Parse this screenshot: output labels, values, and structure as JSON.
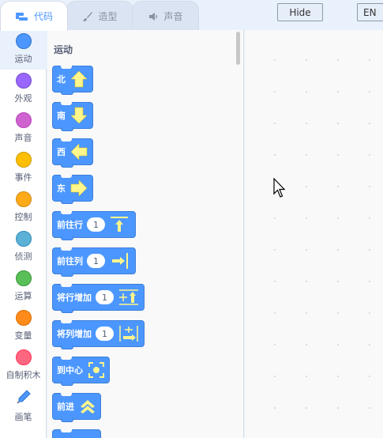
{
  "tabs": [
    {
      "label": "代码",
      "icon": "code-icon",
      "active": true
    },
    {
      "label": "造型",
      "icon": "brush-icon",
      "active": false
    },
    {
      "label": "声音",
      "icon": "speaker-icon",
      "active": false
    }
  ],
  "header_buttons": {
    "hide_label": "Hide",
    "lang_label": "EN"
  },
  "categories": [
    {
      "label": "运动",
      "color": "#4c97ff"
    },
    {
      "label": "外观",
      "color": "#9966ff"
    },
    {
      "label": "声音",
      "color": "#cf63cf"
    },
    {
      "label": "事件",
      "color": "#ffbf00"
    },
    {
      "label": "控制",
      "color": "#ffab19"
    },
    {
      "label": "侦测",
      "color": "#5cb1d6"
    },
    {
      "label": "运算",
      "color": "#59c059"
    },
    {
      "label": "变量",
      "color": "#ff8c1a"
    },
    {
      "label": "自制积木",
      "color": "#ff6680"
    },
    {
      "label": "画笔",
      "icon": "pen-icon"
    }
  ],
  "palette": {
    "title": "运动",
    "blocks": [
      {
        "label": "北",
        "icon": "arrow-up-icon"
      },
      {
        "label": "南",
        "icon": "arrow-down-icon"
      },
      {
        "label": "西",
        "icon": "arrow-left-icon"
      },
      {
        "label": "东",
        "icon": "arrow-right-icon"
      },
      {
        "label": "前往行",
        "value": "1",
        "icon": "goto-row-icon"
      },
      {
        "label": "前往列",
        "value": "1",
        "icon": "goto-col-icon"
      },
      {
        "label": "将行增加",
        "value": "1",
        "icon": "row-increase-icon"
      },
      {
        "label": "将列增加",
        "value": "1",
        "icon": "col-increase-icon"
      },
      {
        "label": "到中心",
        "icon": "center-icon"
      },
      {
        "label": "前进",
        "icon": "forward-icon"
      }
    ]
  }
}
